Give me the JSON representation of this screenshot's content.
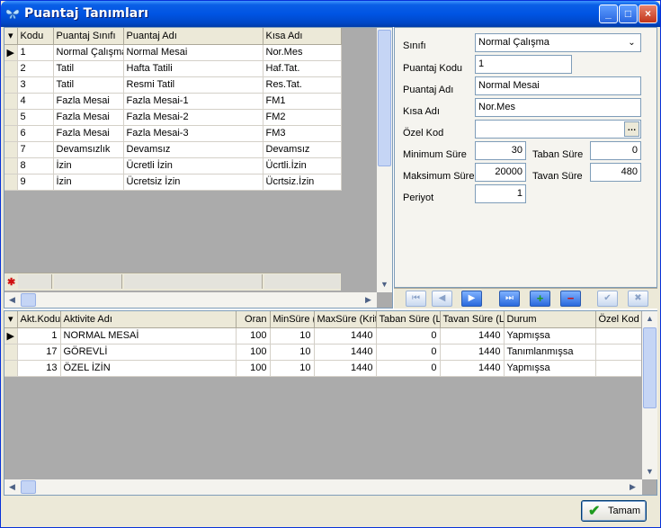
{
  "window": {
    "title": "Puantaj Tanımları"
  },
  "grid1": {
    "columns": [
      "Kodu",
      "Puantaj Sınıfı",
      "Puantaj Adı",
      "Kısa Adı"
    ],
    "rows": [
      [
        "1",
        "Normal Çalışma",
        "Normal Mesai",
        "Nor.Mes"
      ],
      [
        "2",
        "Tatil",
        "Hafta Tatili",
        "Haf.Tat."
      ],
      [
        "3",
        "Tatil",
        "Resmi Tatil",
        "Res.Tat."
      ],
      [
        "4",
        "Fazla Mesai",
        "Fazla Mesai-1",
        "FM1"
      ],
      [
        "5",
        "Fazla Mesai",
        "Fazla Mesai-2",
        "FM2"
      ],
      [
        "6",
        "Fazla Mesai",
        "Fazla Mesai-3",
        "FM3"
      ],
      [
        "7",
        "Devamsızlık",
        "Devamsız",
        "Devamsız"
      ],
      [
        "8",
        "İzin",
        "Ücretli İzin",
        "Ücrtli.İzin"
      ],
      [
        "9",
        "İzin",
        "Ücretsiz İzin",
        "Ücrtsiz.İzin"
      ]
    ]
  },
  "form": {
    "sinifi_label": "Sınıfı",
    "sinifi_value": "Normal Çalışma",
    "kodu_label": "Puantaj Kodu",
    "kodu_value": "1",
    "adi_label": "Puantaj Adı",
    "adi_value": "Normal Mesai",
    "kisa_label": "Kısa Adı",
    "kisa_value": "Nor.Mes",
    "ozel_label": "Özel Kod",
    "ozel_value": "",
    "min_label": "Minimum Süre",
    "min_value": "30",
    "taban_label": "Taban Süre",
    "taban_value": "0",
    "max_label": "Maksimum Süre",
    "max_value": "20000",
    "tavan_label": "Tavan Süre",
    "tavan_value": "480",
    "periyot_label": "Periyot",
    "periyot_value": "1"
  },
  "navigator": {
    "first": "⏮",
    "prior": "◀",
    "next": "▶",
    "last": "⏭",
    "insert": "+",
    "delete": "−",
    "post": "✔",
    "cancel": "✖"
  },
  "grid2": {
    "columns": [
      "Akt.Kodu",
      "Aktivite  Adı",
      "Oran",
      "MinSüre (",
      "MaxSüre (Krite",
      "Taban Süre (L",
      "Tavan Süre (L",
      "Durum",
      "Özel Kod"
    ],
    "rows": [
      [
        "1",
        "NORMAL MESAİ",
        "100",
        "10",
        "1440",
        "0",
        "1440",
        "Yapmışsa",
        ""
      ],
      [
        "17",
        "GÖREVLİ",
        "100",
        "10",
        "1440",
        "0",
        "1440",
        "Tanımlanmışsa",
        ""
      ],
      [
        "13",
        "ÖZEL İZİN",
        "100",
        "10",
        "1440",
        "0",
        "1440",
        "Yapmışsa",
        ""
      ]
    ]
  },
  "footer": {
    "ok_label": "Tamam"
  },
  "colors": {
    "titlebar": "#0054e3",
    "grid_bg": "#ababab",
    "face": "#ece9d8",
    "ok_icon": "#1e9b1e",
    "delete_icon": "#d01010"
  },
  "icons": {
    "title": "butterfly-icon",
    "ok": "checkmark-icon",
    "ellipsis": "ellipsis-icon",
    "row_indicator": "current-row-icon"
  }
}
